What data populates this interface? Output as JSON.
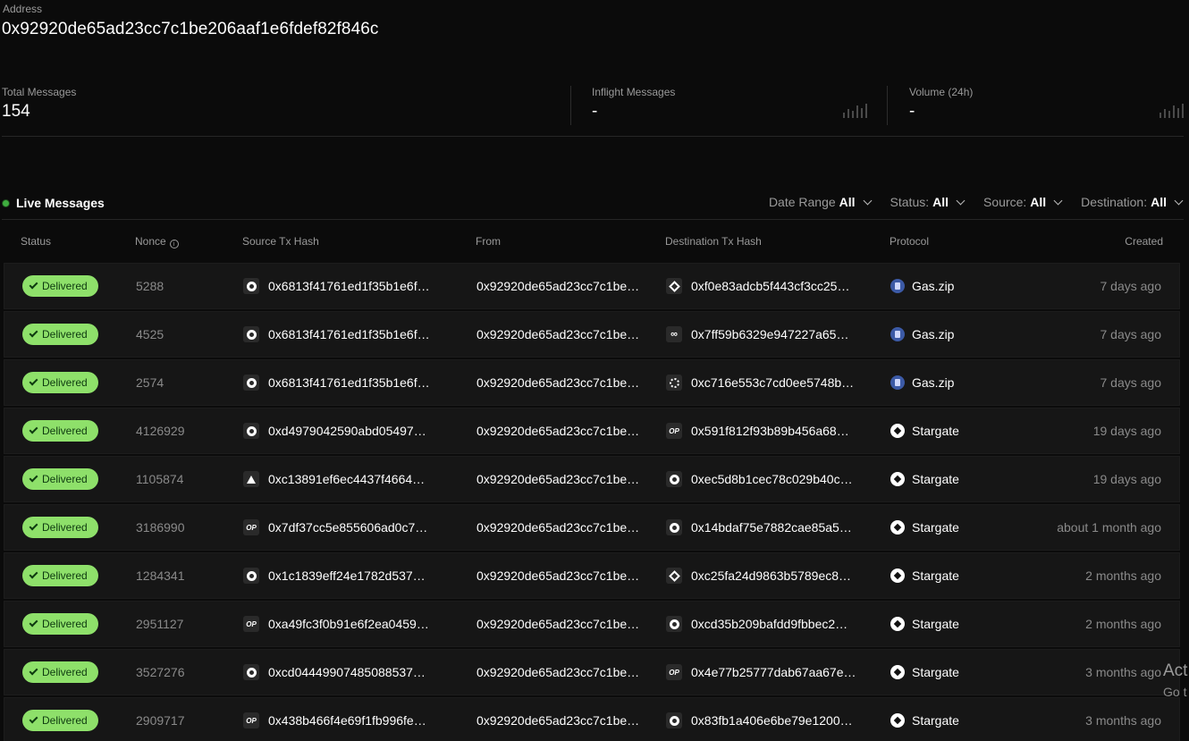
{
  "address": {
    "label": "Address",
    "value": "0x92920de65ad23cc7c1be206aaf1e6fdef82f846c"
  },
  "stats": {
    "total": {
      "label": "Total Messages",
      "value": "154"
    },
    "inflight": {
      "label": "Inflight Messages",
      "value": "-"
    },
    "volume": {
      "label": "Volume (24h)",
      "value": "-"
    }
  },
  "live": {
    "title": "Live Messages",
    "status_color": "#3fae3f",
    "filters": {
      "date_range": {
        "label": "Date Range",
        "value": "All"
      },
      "status": {
        "label": "Status:",
        "value": "All"
      },
      "source": {
        "label": "Source:",
        "value": "All"
      },
      "destination": {
        "label": "Destination:",
        "value": "All"
      }
    }
  },
  "table": {
    "headers": {
      "status": "Status",
      "nonce": "Nonce",
      "source_tx": "Source Tx Hash",
      "from": "From",
      "dest_tx": "Destination Tx Hash",
      "protocol": "Protocol",
      "created": "Created"
    },
    "rows": [
      {
        "status": "Delivered",
        "nonce": "5288",
        "src_icon": "arbitrum-icon",
        "src_hash": "0x6813f41761ed1f35b1e6f…",
        "from": "0x92920de65ad23cc7c1be…",
        "dst_icon": "bnb-icon",
        "dst_hash": "0xf0e83adcb5f443cf3cc25…",
        "protocol_icon": "gaszip-icon",
        "protocol": "Gas.zip",
        "created": "7 days ago"
      },
      {
        "status": "Delivered",
        "nonce": "4525",
        "src_icon": "arbitrum-icon",
        "src_hash": "0x6813f41761ed1f35b1e6f…",
        "from": "0x92920de65ad23cc7c1be…",
        "dst_icon": "link-chain-icon",
        "dst_hash": "0x7ff59b6329e947227a65…",
        "protocol_icon": "gaszip-icon",
        "protocol": "Gas.zip",
        "created": "7 days ago"
      },
      {
        "status": "Delivered",
        "nonce": "2574",
        "src_icon": "arbitrum-icon",
        "src_hash": "0x6813f41761ed1f35b1e6f…",
        "from": "0x92920de65ad23cc7c1be…",
        "dst_icon": "sun-chain-icon",
        "dst_hash": "0xc716e553c7cd0ee5748b…",
        "protocol_icon": "gaszip-icon",
        "protocol": "Gas.zip",
        "created": "7 days ago"
      },
      {
        "status": "Delivered",
        "nonce": "4126929",
        "src_icon": "arbitrum-icon",
        "src_hash": "0xd4979042590abd05497…",
        "from": "0x92920de65ad23cc7c1be…",
        "dst_icon": "optimism-icon",
        "dst_hash": "0x591f812f93b89b456a68…",
        "protocol_icon": "stargate-icon",
        "protocol": "Stargate",
        "created": "19 days ago"
      },
      {
        "status": "Delivered",
        "nonce": "1105874",
        "src_icon": "avalanche-icon",
        "src_hash": "0xc13891ef6ec4437f4664…",
        "from": "0x92920de65ad23cc7c1be…",
        "dst_icon": "arbitrum-icon",
        "dst_hash": "0xec5d8b1cec78c029b40c…",
        "protocol_icon": "stargate-icon",
        "protocol": "Stargate",
        "created": "19 days ago"
      },
      {
        "status": "Delivered",
        "nonce": "3186990",
        "src_icon": "optimism-icon",
        "src_hash": "0x7df37cc5e855606ad0c7…",
        "from": "0x92920de65ad23cc7c1be…",
        "dst_icon": "arbitrum-icon",
        "dst_hash": "0x14bdaf75e7882cae85a5…",
        "protocol_icon": "stargate-icon",
        "protocol": "Stargate",
        "created": "about 1 month ago"
      },
      {
        "status": "Delivered",
        "nonce": "1284341",
        "src_icon": "arbitrum-icon",
        "src_hash": "0x1c1839eff24e1782d537…",
        "from": "0x92920de65ad23cc7c1be…",
        "dst_icon": "bnb-icon",
        "dst_hash": "0xc25fa24d9863b5789ec8…",
        "protocol_icon": "stargate-icon",
        "protocol": "Stargate",
        "created": "2 months ago"
      },
      {
        "status": "Delivered",
        "nonce": "2951127",
        "src_icon": "optimism-icon",
        "src_hash": "0xa49fc3f0b91e6f2ea0459…",
        "from": "0x92920de65ad23cc7c1be…",
        "dst_icon": "arbitrum-icon",
        "dst_hash": "0xcd35b209bafdd9fbbec2…",
        "protocol_icon": "stargate-icon",
        "protocol": "Stargate",
        "created": "2 months ago"
      },
      {
        "status": "Delivered",
        "nonce": "3527276",
        "src_icon": "arbitrum-icon",
        "src_hash": "0xcd04449907485088537…",
        "from": "0x92920de65ad23cc7c1be…",
        "dst_icon": "optimism-icon",
        "dst_hash": "0x4e77b25777dab67aa67e…",
        "protocol_icon": "stargate-icon",
        "protocol": "Stargate",
        "created": "3 months ago"
      },
      {
        "status": "Delivered",
        "nonce": "2909717",
        "src_icon": "optimism-icon",
        "src_hash": "0x438b466f4e69f1fb996fe…",
        "from": "0x92920de65ad23cc7c1be…",
        "dst_icon": "arbitrum-icon",
        "dst_hash": "0x83fb1a406e6be79e1200…",
        "protocol_icon": "stargate-icon",
        "protocol": "Stargate",
        "created": "3 months ago"
      }
    ]
  },
  "watermark": {
    "line1": "Act",
    "line2": "Go t"
  },
  "colors": {
    "badge": "#8ee06a",
    "background": "#0b0b0b",
    "row": "#161616"
  }
}
